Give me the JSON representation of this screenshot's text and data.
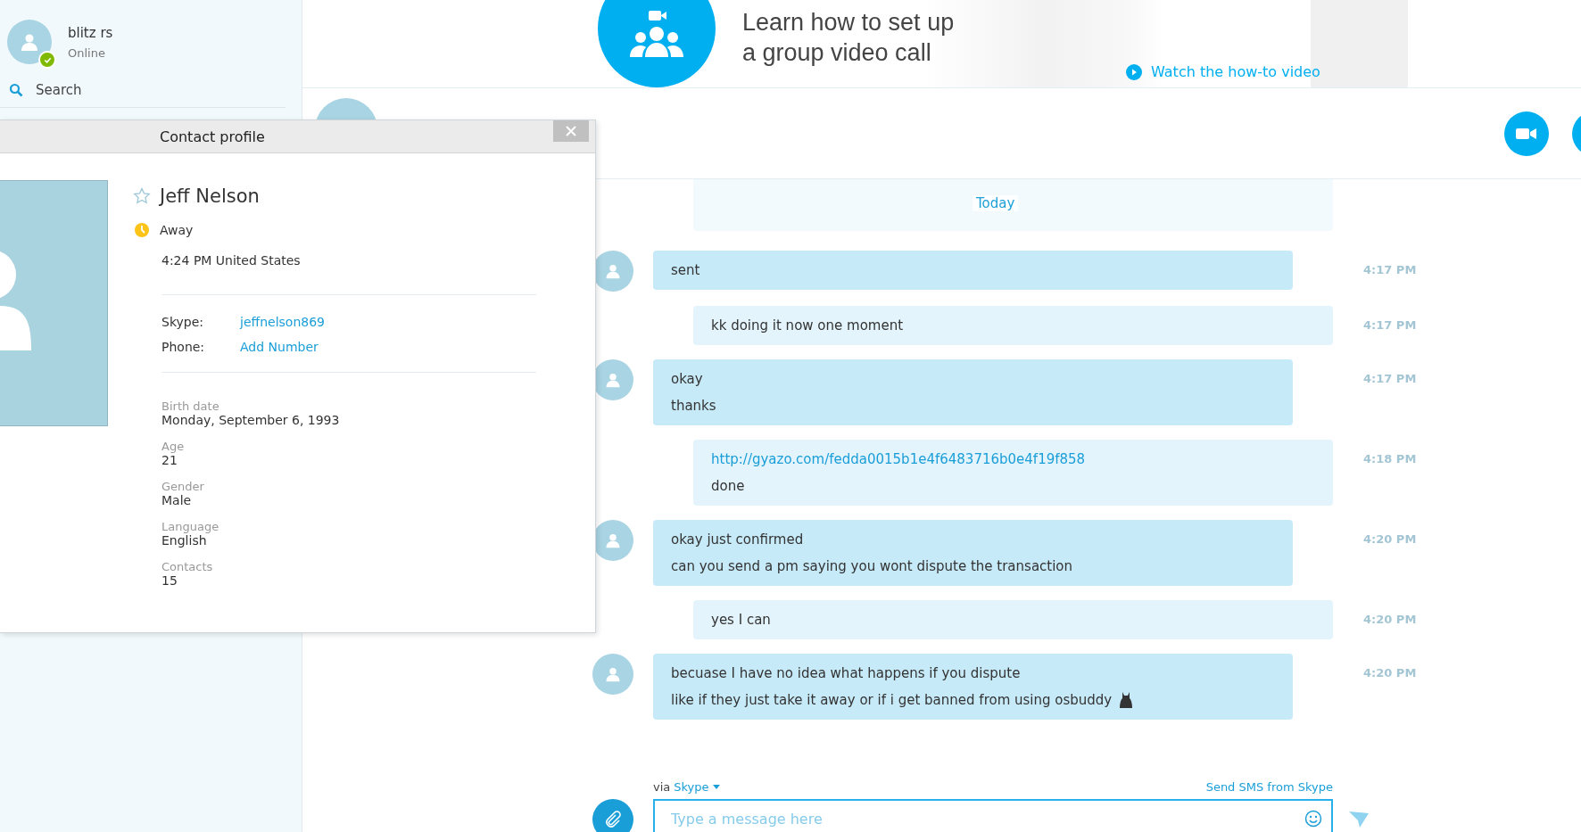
{
  "sidebar": {
    "user": {
      "name": "blitz rs",
      "status": "Online",
      "away": false
    },
    "search": {
      "label": "Search"
    }
  },
  "ad": {
    "headline": [
      "Learn how to set up",
      "a group video call"
    ],
    "link": "Watch the how-to video"
  },
  "contact_profile": {
    "title": "Contact profile",
    "name": "Jeff Nelson",
    "favorite": false,
    "status": "Away",
    "away": true,
    "local_time": "4:24 PM United States",
    "accounts": [
      {
        "label": "Skype:",
        "value": "jeffnelson869"
      },
      {
        "label": "Phone:",
        "value": "Add Number"
      }
    ],
    "details": [
      {
        "label": "Birth date",
        "value": "Monday, September 6, 1993"
      },
      {
        "label": "Age",
        "value": "21"
      },
      {
        "label": "Gender",
        "value": "Male"
      },
      {
        "label": "Language",
        "value": "English"
      },
      {
        "label": "Contacts",
        "value": "15"
      }
    ]
  },
  "chat": {
    "date_divider": "Today",
    "messages": [
      {
        "outgoing": false,
        "lines": [
          {
            "kind": "text",
            "text": "sent"
          }
        ],
        "time": "4:17 PM",
        "emoticon": false
      },
      {
        "outgoing": true,
        "lines": [
          {
            "kind": "text",
            "text": "kk doing it now one moment"
          }
        ],
        "time": "4:17 PM",
        "emoticon": false
      },
      {
        "outgoing": false,
        "lines": [
          {
            "kind": "text",
            "text": "okay"
          },
          {
            "kind": "text",
            "text": "thanks"
          }
        ],
        "time": "4:17 PM",
        "emoticon": false
      },
      {
        "outgoing": true,
        "lines": [
          {
            "kind": "link",
            "text": "http://gyazo.com/fedda0015b1e4f6483716b0e4f19f858"
          },
          {
            "kind": "text",
            "text": "done"
          }
        ],
        "time": "4:18 PM",
        "emoticon": false
      },
      {
        "outgoing": false,
        "lines": [
          {
            "kind": "text",
            "text": "okay just confirmed"
          },
          {
            "kind": "text",
            "text": "can you send a pm saying you wont dispute the transaction"
          }
        ],
        "time": "4:20 PM",
        "emoticon": false
      },
      {
        "outgoing": true,
        "lines": [
          {
            "kind": "text",
            "text": "yes I can"
          }
        ],
        "time": "4:20 PM",
        "emoticon": false
      },
      {
        "outgoing": false,
        "lines": [
          {
            "kind": "text",
            "text": "becuase I have no idea what happens if you dispute"
          },
          {
            "kind": "text",
            "text": "like if they just take it away or if i get banned from using osbuddy"
          }
        ],
        "time": "4:20 PM",
        "emoticon": true
      }
    ],
    "composer": {
      "via": "via",
      "service": "Skype",
      "sms_link": "Send SMS from Skype",
      "placeholder": "Type a message here"
    }
  }
}
